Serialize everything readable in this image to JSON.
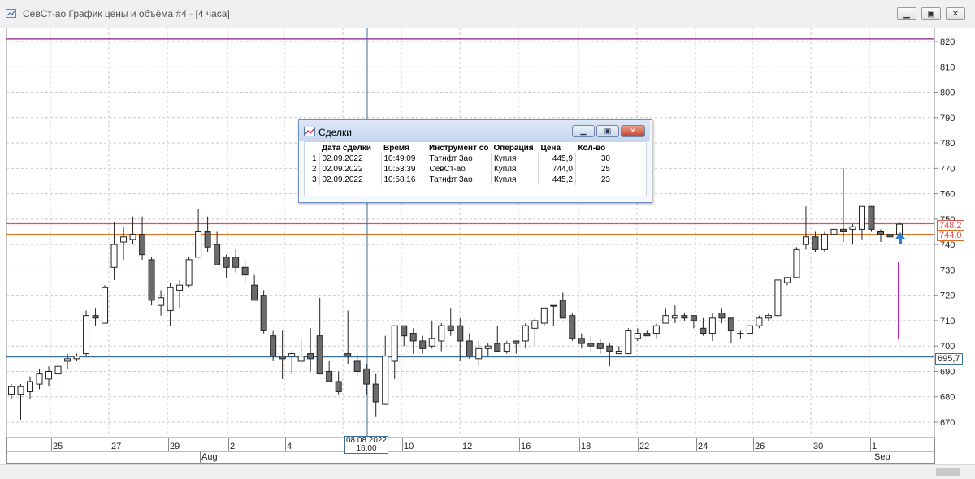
{
  "window": {
    "title": "СевСт-ао График цены и объёма #4 - [4 часа]"
  },
  "chart_data": {
    "type": "candlestick",
    "y_ticks": [
      670,
      680,
      690,
      700,
      710,
      720,
      730,
      740,
      750,
      760,
      770,
      780,
      790,
      800,
      810,
      820
    ],
    "ylim": [
      665.5,
      822.5
    ],
    "x_tick_labels": [
      "25",
      "27",
      "29",
      "2",
      "4",
      "10",
      "12",
      "16",
      "18",
      "22",
      "24",
      "26",
      "30",
      "1"
    ],
    "month_labels": [
      "Aug",
      "Sep"
    ],
    "crosshair_label": [
      "08.08.2022",
      "16:00"
    ],
    "price_lines": [
      {
        "value": 821,
        "color": "#8b1a8b",
        "label": ""
      },
      {
        "value": 748.2,
        "color": "#d9534f",
        "label": "748,2"
      },
      {
        "value": 744.0,
        "color": "#e07020",
        "label": "744,0"
      },
      {
        "value": 695.7,
        "color": "#3a6f9a",
        "label": "695,7"
      }
    ],
    "candles": [
      {
        "o": 681,
        "h": 685,
        "l": 679,
        "c": 684
      },
      {
        "o": 681,
        "h": 685,
        "l": 671,
        "c": 684
      },
      {
        "o": 682,
        "h": 688,
        "l": 679,
        "c": 686
      },
      {
        "o": 685,
        "h": 691,
        "l": 683,
        "c": 689
      },
      {
        "o": 687,
        "h": 692,
        "l": 684,
        "c": 690
      },
      {
        "o": 689,
        "h": 697,
        "l": 681,
        "c": 692
      },
      {
        "o": 694,
        "h": 697,
        "l": 691,
        "c": 695
      },
      {
        "o": 695,
        "h": 697,
        "l": 694,
        "c": 696
      },
      {
        "o": 697,
        "h": 714,
        "l": 696,
        "c": 712
      },
      {
        "o": 712,
        "h": 715,
        "l": 708,
        "c": 711
      },
      {
        "o": 709,
        "h": 724,
        "l": 709,
        "c": 723
      },
      {
        "o": 731,
        "h": 749,
        "l": 726,
        "c": 740
      },
      {
        "o": 741,
        "h": 747,
        "l": 734,
        "c": 743
      },
      {
        "o": 742,
        "h": 751,
        "l": 740,
        "c": 744
      },
      {
        "o": 744,
        "h": 751,
        "l": 734,
        "c": 736
      },
      {
        "o": 734,
        "h": 735,
        "l": 716,
        "c": 718
      },
      {
        "o": 716,
        "h": 722,
        "l": 712,
        "c": 719
      },
      {
        "o": 714,
        "h": 725,
        "l": 708,
        "c": 723
      },
      {
        "o": 722,
        "h": 726,
        "l": 715,
        "c": 724
      },
      {
        "o": 724,
        "h": 735,
        "l": 723,
        "c": 734
      },
      {
        "o": 735,
        "h": 754,
        "l": 735,
        "c": 745
      },
      {
        "o": 745,
        "h": 751,
        "l": 737,
        "c": 739
      },
      {
        "o": 740,
        "h": 745,
        "l": 732,
        "c": 732
      },
      {
        "o": 735,
        "h": 736,
        "l": 727,
        "c": 731
      },
      {
        "o": 735,
        "h": 738,
        "l": 729,
        "c": 731
      },
      {
        "o": 731,
        "h": 734,
        "l": 725,
        "c": 728
      },
      {
        "o": 724,
        "h": 728,
        "l": 718,
        "c": 718
      },
      {
        "o": 720,
        "h": 722,
        "l": 705,
        "c": 706
      },
      {
        "o": 704,
        "h": 706,
        "l": 694,
        "c": 696
      },
      {
        "o": 696,
        "h": 706,
        "l": 687,
        "c": 695
      },
      {
        "o": 696,
        "h": 698,
        "l": 689,
        "c": 697
      },
      {
        "o": 694,
        "h": 703,
        "l": 694,
        "c": 696
      },
      {
        "o": 697,
        "h": 707,
        "l": 690,
        "c": 695
      },
      {
        "o": 704,
        "h": 719,
        "l": 690,
        "c": 689
      },
      {
        "o": 690,
        "h": 694,
        "l": 686,
        "c": 686
      },
      {
        "o": 686,
        "h": 690,
        "l": 681,
        "c": 682
      },
      {
        "o": 697,
        "h": 714,
        "l": 693,
        "c": 696
      },
      {
        "o": 694,
        "h": 697,
        "l": 688,
        "c": 690
      },
      {
        "o": 691,
        "h": 693,
        "l": 681,
        "c": 685
      },
      {
        "o": 685,
        "h": 689,
        "l": 672,
        "c": 678
      },
      {
        "o": 677,
        "h": 704,
        "l": 677,
        "c": 696
      },
      {
        "o": 694,
        "h": 708,
        "l": 687,
        "c": 708
      },
      {
        "o": 708,
        "h": 708,
        "l": 700,
        "c": 704
      },
      {
        "o": 705,
        "h": 707,
        "l": 697,
        "c": 702
      },
      {
        "o": 702,
        "h": 704,
        "l": 697,
        "c": 699
      },
      {
        "o": 700,
        "h": 710,
        "l": 699,
        "c": 703
      },
      {
        "o": 702,
        "h": 709,
        "l": 698,
        "c": 708
      },
      {
        "o": 708,
        "h": 715,
        "l": 704,
        "c": 706
      },
      {
        "o": 708,
        "h": 711,
        "l": 694,
        "c": 702
      },
      {
        "o": 702,
        "h": 705,
        "l": 695,
        "c": 696
      },
      {
        "o": 695,
        "h": 702,
        "l": 692,
        "c": 699
      },
      {
        "o": 699,
        "h": 701,
        "l": 696,
        "c": 700
      },
      {
        "o": 701,
        "h": 708,
        "l": 698,
        "c": 698
      },
      {
        "o": 698,
        "h": 702,
        "l": 697,
        "c": 701
      },
      {
        "o": 702,
        "h": 702,
        "l": 697,
        "c": 701
      },
      {
        "o": 702,
        "h": 709,
        "l": 699,
        "c": 708
      },
      {
        "o": 707,
        "h": 711,
        "l": 700,
        "c": 710
      },
      {
        "o": 709,
        "h": 714,
        "l": 708,
        "c": 715
      },
      {
        "o": 716,
        "h": 716,
        "l": 708,
        "c": 716
      },
      {
        "o": 718,
        "h": 721,
        "l": 712,
        "c": 711
      },
      {
        "o": 712,
        "h": 713,
        "l": 702,
        "c": 703
      },
      {
        "o": 703,
        "h": 705,
        "l": 699,
        "c": 701
      },
      {
        "o": 701,
        "h": 704,
        "l": 698,
        "c": 700
      },
      {
        "o": 701,
        "h": 703,
        "l": 697,
        "c": 699
      },
      {
        "o": 700,
        "h": 701,
        "l": 692,
        "c": 698
      },
      {
        "o": 697,
        "h": 700,
        "l": 697,
        "c": 698
      },
      {
        "o": 697,
        "h": 707,
        "l": 697,
        "c": 706
      },
      {
        "o": 703,
        "h": 707,
        "l": 702,
        "c": 705
      },
      {
        "o": 705,
        "h": 706,
        "l": 704,
        "c": 704
      },
      {
        "o": 705,
        "h": 709,
        "l": 703,
        "c": 708
      },
      {
        "o": 709,
        "h": 715,
        "l": 709,
        "c": 712
      },
      {
        "o": 711,
        "h": 716,
        "l": 709,
        "c": 712
      },
      {
        "o": 712,
        "h": 713,
        "l": 710,
        "c": 711
      },
      {
        "o": 712,
        "h": 712,
        "l": 707,
        "c": 710
      },
      {
        "o": 707,
        "h": 711,
        "l": 704,
        "c": 705
      },
      {
        "o": 705,
        "h": 713,
        "l": 702,
        "c": 711
      },
      {
        "o": 713,
        "h": 715,
        "l": 709,
        "c": 711
      },
      {
        "o": 711,
        "h": 711,
        "l": 701,
        "c": 706
      },
      {
        "o": 705,
        "h": 706,
        "l": 703,
        "c": 705
      },
      {
        "o": 705,
        "h": 708,
        "l": 705,
        "c": 708
      },
      {
        "o": 708,
        "h": 712,
        "l": 707,
        "c": 711
      },
      {
        "o": 711,
        "h": 713,
        "l": 710,
        "c": 712
      },
      {
        "o": 712,
        "h": 727,
        "l": 711,
        "c": 726
      },
      {
        "o": 725,
        "h": 727,
        "l": 724,
        "c": 727
      },
      {
        "o": 727,
        "h": 739,
        "l": 727,
        "c": 738
      },
      {
        "o": 740,
        "h": 755,
        "l": 738,
        "c": 743
      },
      {
        "o": 743,
        "h": 745,
        "l": 737,
        "c": 738
      },
      {
        "o": 738,
        "h": 745,
        "l": 737,
        "c": 744
      },
      {
        "o": 744,
        "h": 746,
        "l": 740,
        "c": 746
      },
      {
        "o": 746,
        "h": 770,
        "l": 741,
        "c": 745
      },
      {
        "o": 746,
        "h": 748,
        "l": 740,
        "c": 747
      },
      {
        "o": 746,
        "h": 755,
        "l": 742,
        "c": 755
      },
      {
        "o": 755,
        "h": 755,
        "l": 745,
        "c": 746
      },
      {
        "o": 745,
        "h": 746,
        "l": 741,
        "c": 744
      },
      {
        "o": 744,
        "h": 754,
        "l": 742,
        "c": 743
      },
      {
        "o": 744,
        "h": 749,
        "l": 742,
        "c": 748
      }
    ],
    "vertical_marker": {
      "from": 703,
      "to": 733,
      "color": "#c020c0"
    }
  },
  "deals_window": {
    "title": "Сделки",
    "columns": [
      "",
      "Дата сделки",
      "Время",
      "Инструмент со",
      "Операция",
      "Цена",
      "Кол-во"
    ],
    "rows": [
      [
        "1",
        "02.09.2022",
        "10:49:09",
        "Татнфт 3ао",
        "Купля",
        "445,9",
        "30"
      ],
      [
        "2",
        "02.09.2022",
        "10:53:39",
        "СевСт-ао",
        "Купля",
        "744,0",
        "25"
      ],
      [
        "3",
        "02.09.2022",
        "10:58:16",
        "Татнфт 3ао",
        "Купля",
        "445,2",
        "23"
      ]
    ]
  },
  "colors": {
    "bg": "#ffffff",
    "grid": "#c9c9c9",
    "axis": "#8a8a8a",
    "bull": "#ffffff",
    "bear": "#6b6b6b",
    "crosshair": "#3a6f9a"
  }
}
